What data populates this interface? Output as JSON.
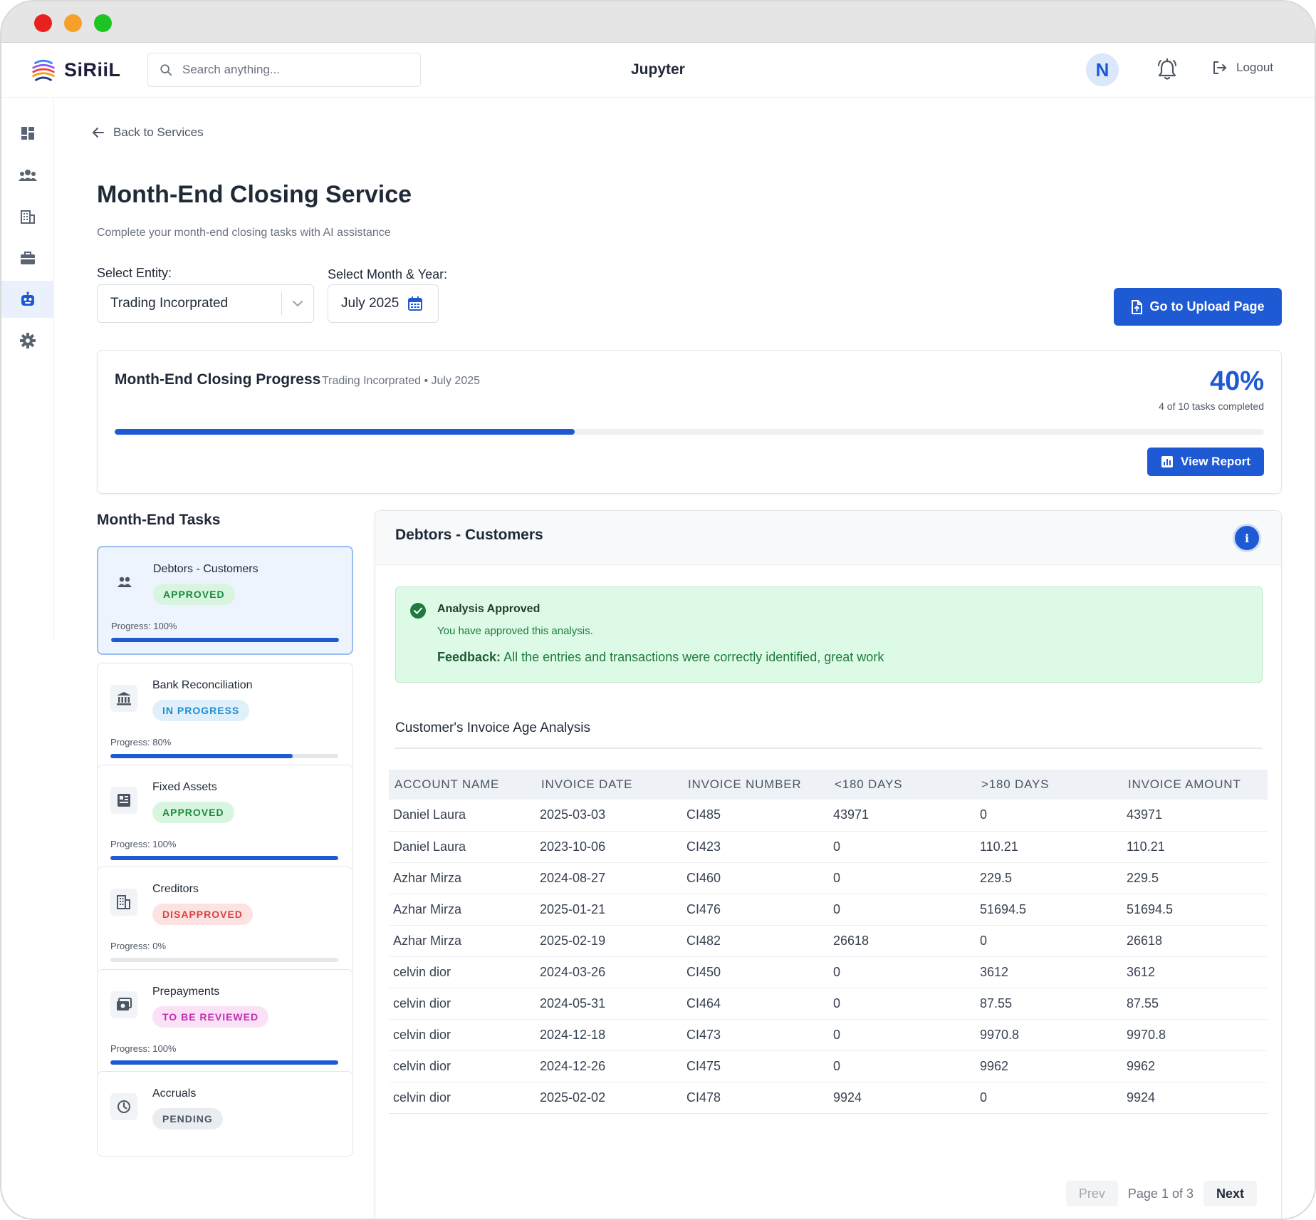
{
  "brand": {
    "name": "SiRiiL"
  },
  "search": {
    "placeholder": "Search anything..."
  },
  "header": {
    "app_title": "Jupyter",
    "avatar_initial": "N",
    "logout_label": "Logout"
  },
  "sidebar": {
    "items": [
      {
        "icon": "dashboard-icon",
        "active": false
      },
      {
        "icon": "users-icon",
        "active": false
      },
      {
        "icon": "building-icon",
        "active": false
      },
      {
        "icon": "briefcase-icon",
        "active": false
      },
      {
        "icon": "robot-icon",
        "active": true
      },
      {
        "icon": "gear-icon",
        "active": false
      }
    ]
  },
  "page": {
    "back_label": "Back to Services",
    "title": "Month-End Closing Service",
    "subtitle": "Complete your month-end closing tasks with AI assistance"
  },
  "filters": {
    "entity_label": "Select Entity:",
    "entity_value": "Trading Incorprated",
    "month_label": "Select Month & Year:",
    "month_value": "July 2025",
    "upload_button": "Go to Upload Page"
  },
  "progress": {
    "title": "Month-End Closing Progress",
    "subtitle": "Trading Incorprated • July 2025",
    "percent_label": "40%",
    "percent": 40,
    "count_label": "4 of 10 tasks completed",
    "view_report": "View Report",
    "accent": "#1e5ad4"
  },
  "tasks": {
    "title": "Month-End Tasks",
    "items": [
      {
        "name": "Debtors - Customers",
        "status": "APPROVED",
        "status_class": "approved",
        "progress_label": "Progress: 100%",
        "progress": 100,
        "icon": "people-icon",
        "selected": true
      },
      {
        "name": "Bank Reconciliation",
        "status": "IN PROGRESS",
        "status_class": "inprogress",
        "progress_label": "Progress: 80%",
        "progress": 80,
        "icon": "bank-icon",
        "selected": false
      },
      {
        "name": "Fixed Assets",
        "status": "APPROVED",
        "status_class": "approved",
        "progress_label": "Progress: 100%",
        "progress": 100,
        "icon": "assets-icon",
        "selected": false
      },
      {
        "name": "Creditors",
        "status": "DISAPPROVED",
        "status_class": "disapproved",
        "progress_label": "Progress: 0%",
        "progress": 0,
        "icon": "building-icon",
        "selected": false
      },
      {
        "name": "Prepayments",
        "status": "TO BE REVIEWED",
        "status_class": "review",
        "progress_label": "Progress: 100%",
        "progress": 100,
        "icon": "prepay-icon",
        "selected": false
      },
      {
        "name": "Accruals",
        "status": "PENDING",
        "status_class": "pending",
        "progress_label": "",
        "progress": null,
        "icon": "clock-icon",
        "selected": false
      }
    ]
  },
  "detail": {
    "title": "Debtors - Customers",
    "info_glyph": "i",
    "approved_title": "Analysis Approved",
    "approved_sub": "You have approved this analysis.",
    "feedback_label": "Feedback:",
    "feedback_text": "All the entries and transactions were correctly identified, great work",
    "analysis_title": "Customer's Invoice Age Analysis",
    "table": {
      "headers": [
        "ACCOUNT NAME",
        "INVOICE DATE",
        "INVOICE NUMBER",
        "<180 DAYS",
        ">180 DAYS",
        "INVOICE AMOUNT"
      ],
      "rows": [
        [
          "Daniel Laura",
          "2025-03-03",
          "CI485",
          "43971",
          "0",
          "43971"
        ],
        [
          "Daniel Laura",
          "2023-10-06",
          "CI423",
          "0",
          "110.21",
          "110.21"
        ],
        [
          "Azhar Mirza",
          "2024-08-27",
          "CI460",
          "0",
          "229.5",
          "229.5"
        ],
        [
          "Azhar Mirza",
          "2025-01-21",
          "CI476",
          "0",
          "51694.5",
          "51694.5"
        ],
        [
          "Azhar Mirza",
          "2025-02-19",
          "CI482",
          "26618",
          "0",
          "26618"
        ],
        [
          "celvin dior",
          "2024-03-26",
          "CI450",
          "0",
          "3612",
          "3612"
        ],
        [
          "celvin dior",
          "2024-05-31",
          "CI464",
          "0",
          "87.55",
          "87.55"
        ],
        [
          "celvin dior",
          "2024-12-18",
          "CI473",
          "0",
          "9970.8",
          "9970.8"
        ],
        [
          "celvin dior",
          "2024-12-26",
          "CI475",
          "0",
          "9962",
          "9962"
        ],
        [
          "celvin dior",
          "2025-02-02",
          "CI478",
          "9924",
          "0",
          "9924"
        ]
      ]
    },
    "pager": {
      "prev": "Prev",
      "info": "Page 1 of 3",
      "next": "Next"
    }
  }
}
